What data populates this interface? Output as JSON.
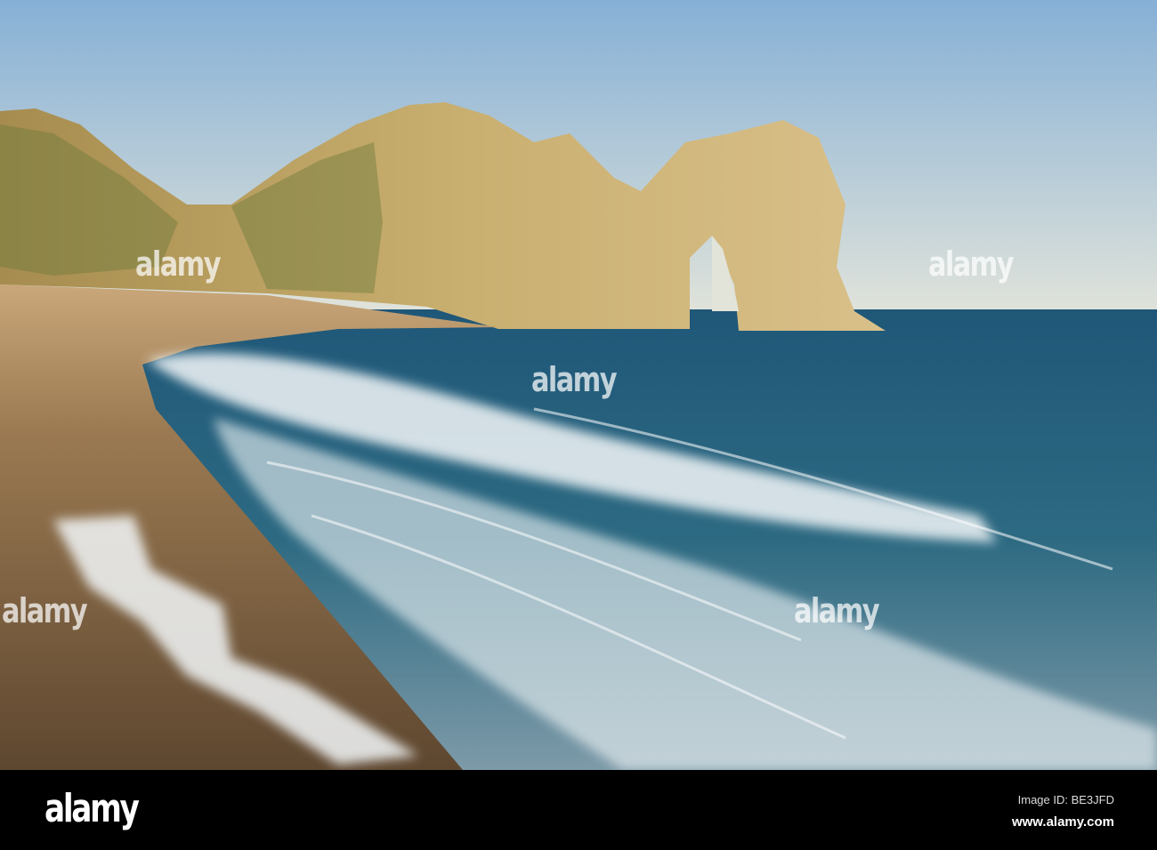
{
  "watermark": "alamy",
  "footer": {
    "logo": "alamy",
    "image_id": "Image ID: BE3JFD",
    "url": "www.alamy.com"
  },
  "colors": {
    "sky_top": "#86b0d6",
    "sky_bottom": "#e2e4da",
    "sea": "#235a78",
    "cliff": "#c2a66a",
    "beach": "#8a6a45"
  }
}
